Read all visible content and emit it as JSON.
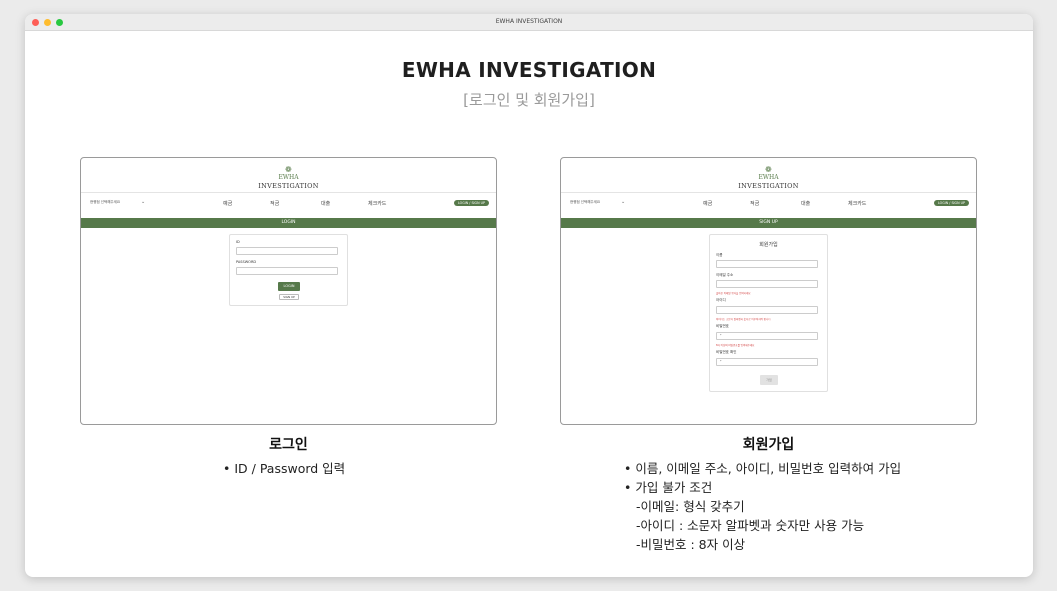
{
  "window": {
    "title": "EWHA INVESTIGATION"
  },
  "page": {
    "title": "EWHA INVESTIGATION",
    "subtitle": "[로그인 및 회원가입]"
  },
  "mockup": {
    "logo_line1": "EWHA",
    "logo_line2": "INVESTIGATION",
    "branch_select": "현행점 선택해주세요",
    "nav": [
      "예금",
      "적금",
      "대출",
      "체크카드"
    ],
    "auth_button": "LOGIN / SIGN UP"
  },
  "login_screen": {
    "bar": "LOGIN",
    "id_label": "ID",
    "password_label": "PASSWORD",
    "login_button": "LOGIN",
    "signup_button": "SIGN UP"
  },
  "signup_screen": {
    "bar": "SIGN UP",
    "title": "회원가입",
    "name_label": "이름",
    "email_label": "이메일 주소",
    "email_error": "올바른 이메일 형식을 입력하세요",
    "id_label": "아이디",
    "id_error": "아이디는 소문자 알파벳과 숫자로 이루어져야 합니다",
    "password_label": "비밀번호",
    "password_value": "*",
    "password_error": "8자 이상의 비밀번호를 입력해주세요",
    "password_confirm_label": "비밀번호 확인",
    "password_confirm_value": "*",
    "submit_button": "가입"
  },
  "captions": {
    "login_title": "로그인",
    "login_bullet": "• ID / Password 입력",
    "signup_title": "회원가입",
    "signup_lines": [
      "• 이름, 이메일 주소, 아이디, 비밀번호 입력하여 가입",
      "• 가입 불가 조건",
      "-이메일: 형식 갖추기",
      "-아이디 : 소문자 알파벳과 숫자만 사용 가능",
      "-비밀번호 : 8자 이상"
    ]
  },
  "colors": {
    "brand_green": "#56794a",
    "error_red": "#d03b3b"
  }
}
